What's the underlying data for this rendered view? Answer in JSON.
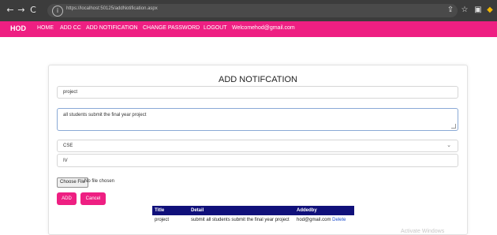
{
  "browser": {
    "back": "←",
    "forward": "→",
    "reload": "C",
    "url": "https://localhost:50125/addNotification.aspx",
    "toolbar_icons": [
      "share-icon",
      "star-icon",
      "sidebar-icon",
      "extension-icon"
    ]
  },
  "navbar": {
    "brand": "HOD",
    "links": [
      "HOME",
      "ADD CC",
      "ADD NOTIFICATION",
      "CHANGE PASSWORD",
      "LOGOUT",
      "Welcomehod@gmail.com"
    ],
    "color": "#ee1f82"
  },
  "form": {
    "title": "ADD NOTIFCATION",
    "title_value": "project",
    "detail_value": "all students submit the final year project",
    "department_selected": "CSE",
    "year_value": "IV",
    "file_button": "Choose File",
    "file_status": "No file chosen",
    "add_button": "ADD",
    "cancel_button": "Cancel"
  },
  "table": {
    "headers": [
      "Title",
      "Detail",
      "Addedby"
    ],
    "rows": [
      {
        "title": "project",
        "detail": "submit all students submit the final year project",
        "addedby": "hod@gmail.com",
        "action": "Delete"
      }
    ],
    "header_color": "#10107a"
  },
  "watermark": "Activate Windows"
}
